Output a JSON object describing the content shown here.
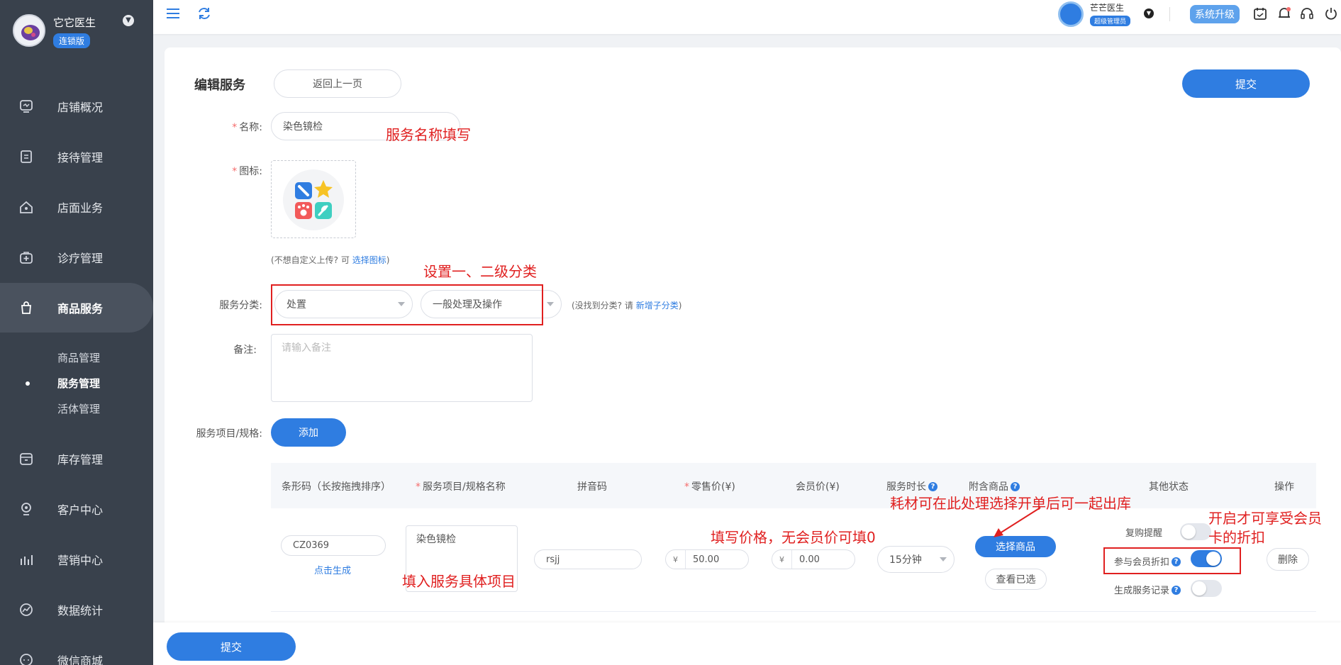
{
  "brand": {
    "name": "它它医生",
    "badge": "连锁版"
  },
  "nav": {
    "items": [
      {
        "label": "店铺概况"
      },
      {
        "label": "接待管理"
      },
      {
        "label": "店面业务"
      },
      {
        "label": "诊疗管理"
      },
      {
        "label": "商品服务",
        "active": true
      },
      {
        "label": "库存管理"
      },
      {
        "label": "客户中心"
      },
      {
        "label": "营销中心"
      },
      {
        "label": "数据统计"
      },
      {
        "label": "微信商城"
      }
    ],
    "sub_items": [
      {
        "label": "商品管理"
      },
      {
        "label": "服务管理",
        "active": true
      },
      {
        "label": "活体管理"
      }
    ]
  },
  "topbar": {
    "user_name": "芒芒医生",
    "user_role": "超级管理员",
    "upgrade_label": "系统升级"
  },
  "page": {
    "title": "编辑服务",
    "back_label": "返回上一页",
    "submit_label": "提交",
    "bottom_submit_label": "提交"
  },
  "form": {
    "name_label": "名称:",
    "name_value": "染色镜检",
    "icon_label": "图标:",
    "icon_hint_prefix": "(不想自定义上传? 可",
    "icon_hint_link": "选择图标",
    "icon_hint_suffix": ")",
    "category_label": "服务分类:",
    "category_1": "处置",
    "category_2": "一般处理及操作",
    "category_hint_prefix": "(没找到分类? 请",
    "category_hint_link": "新增子分类",
    "category_hint_suffix": ")",
    "remark_label": "备注:",
    "remark_placeholder": "请输入备注",
    "items_label": "服务项目/规格:",
    "add_label": "添加"
  },
  "table": {
    "headers": {
      "barcode": "条形码（长按拖拽排序）",
      "name": "服务项目/规格名称",
      "pinyin": "拼音码",
      "retail": "零售价(¥)",
      "member": "会员价(¥)",
      "duration": "服务时长",
      "goods": "附含商品",
      "status": "其他状态",
      "ops": "操作"
    },
    "row": {
      "barcode": "CZ0369",
      "generate": "点击生成",
      "name": "染色镜检",
      "pinyin": "rsjj",
      "currency": "¥",
      "retail": "50.00",
      "member": "0.00",
      "duration": "15分钟",
      "select_goods": "选择商品",
      "view_selected": "查看已选",
      "repurchase_label": "复购提醒",
      "repurchase_on": false,
      "member_discount_label": "参与会员折扣",
      "member_discount_on": true,
      "gen_record_label": "生成服务记录",
      "gen_record_on": false,
      "delete_label": "删除"
    }
  },
  "annotations": {
    "name_note": "服务名称填写",
    "category_note": "设置一、二级分类",
    "goods_note": "耗材可在此处理选择开单后可一起出库",
    "price_note": "填写价格，无会员价可填0",
    "item_note": "填入服务具体项目",
    "discount_note_1": "开启才可享受会员",
    "discount_note_2": "卡的折扣"
  },
  "colors": {
    "primary": "#2f7de1",
    "sidebar": "#39414c",
    "annotation": "#e02020"
  }
}
